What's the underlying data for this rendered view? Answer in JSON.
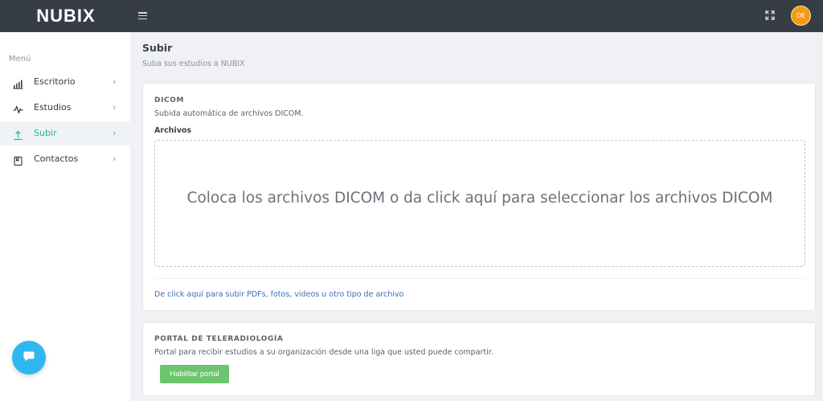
{
  "header": {
    "brand": "NUBIX",
    "avatar_initials": "DE",
    "colors": {
      "bar": "#373d45",
      "avatar": "#f39c12"
    }
  },
  "sidebar": {
    "menu_title": "Menú",
    "items": [
      {
        "label": "Escritorio",
        "icon": "bar-chart-icon",
        "chevron": "›",
        "active": false
      },
      {
        "label": "Estudios",
        "icon": "activity-icon",
        "chevron": "›",
        "active": false
      },
      {
        "label": "Subir",
        "icon": "upload-icon",
        "chevron": "›",
        "active": true
      },
      {
        "label": "Contactos",
        "icon": "contacts-book-icon",
        "chevron": "›",
        "active": false
      }
    ],
    "accent_color": "#1cbb8c"
  },
  "page": {
    "title": "Subir",
    "subtitle": "Suba sus estudios a NUBIX"
  },
  "dicom": {
    "title": "DICOM",
    "description": "Subida automática de archivos DICOM.",
    "field_label": "Archivos",
    "dropzone_text": "Coloca los archivos DICOM o da click aquí para seleccionar los archivos DICOM",
    "other_files_link": "De click aquí para subir PDFs, fotos, videos u otro tipo de archivo"
  },
  "portal": {
    "title": "PORTAL DE TELERADIOLOGÍA",
    "description": "Portal para recibir estudios a su organización desde una liga que usted puede compartir.",
    "button_label": "Habilitar portal",
    "button_color": "#6cc56d"
  }
}
